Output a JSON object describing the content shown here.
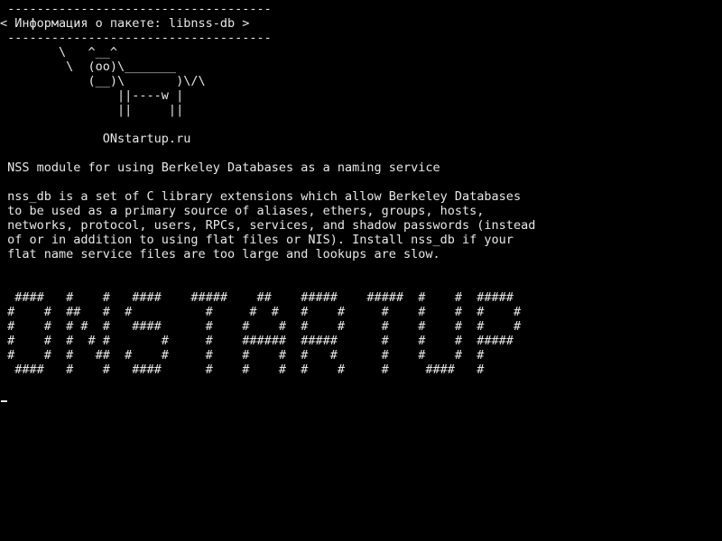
{
  "terminal": {
    "lines": [
      " ------------------------------------",
      "< Информация о пакете: libnss-db >",
      " ------------------------------------",
      "        \\   ^__^",
      "         \\  (oo)\\_______",
      "            (__)\\       )\\/\\",
      "                ||----w |",
      "                ||     ||",
      "",
      "              ONstartup.ru",
      "",
      " NSS module for using Berkeley Databases as a naming service",
      "",
      " nss_db is a set of C library extensions which allow Berkeley Databases",
      " to be used as a primary source of aliases, ethers, groups, hosts,",
      " networks, protocol, users, RPCs, services, and shadow passwords (instead",
      " of or in addition to using flat files or NIS). Install nss_db if your",
      " flat name service files are too large and lookups are slow.",
      "",
      "",
      "  ####   #    #   ####    #####    ##    #####    #####  #    #  #####",
      " #    #  ##   #  #          #     #  #   #    #     #    #    #  #    #",
      " #    #  # #  #   ####      #    #    #  #    #     #    #    #  #    #",
      " #    #  #  # #       #     #    ######  #####      #    #    #  #####",
      " #    #  #   ##  #    #     #    #    #  #   #      #    #    #  #",
      "  ####   #    #   ####      #    #    #  #    #     #     ####   #"
    ]
  }
}
